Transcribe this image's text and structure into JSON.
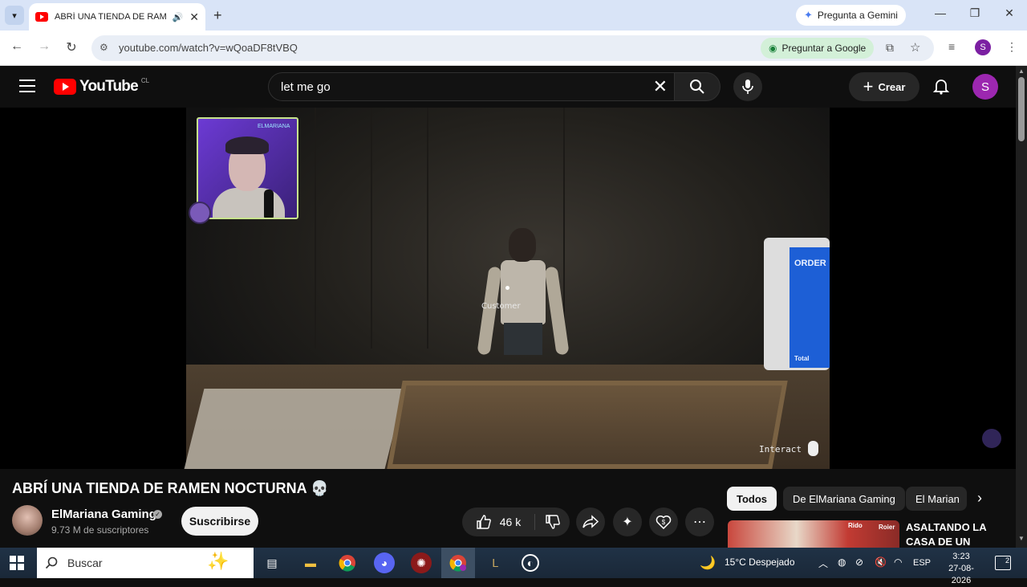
{
  "browser": {
    "tab_title": "ABRÍ UNA TIENDA DE RAMEN",
    "gemini_label": "Pregunta a Gemini",
    "url": "youtube.com/watch?v=wQoaDF8tVBQ",
    "ask_google_label": "Preguntar a Google",
    "profile_initial": "S"
  },
  "youtube": {
    "logo_text": "YouTube",
    "country_code": "CL",
    "search_query": "let me go",
    "create_label": "Crear",
    "avatar_initial": "S"
  },
  "video": {
    "game_label_customer": "Customer",
    "game_prompt_interact": "Interact",
    "kiosk_text": "ORDER",
    "kiosk_total": "Total",
    "webcam_badge": "ELMARIANA"
  },
  "watch": {
    "title": "ABRÍ UNA TIENDA DE RAMEN NOCTURNA 💀",
    "channel_name": "ElMariana Gaming",
    "subscribers": "9.73 M de suscriptores",
    "subscribe_label": "Suscribirse",
    "likes": "46 k"
  },
  "related": {
    "chips": [
      "Todos",
      "De ElMariana Gaming",
      "El Marian"
    ],
    "first_video_title": "ASALTANDO LA CASA DE UN",
    "thumb_labels": [
      "Rido",
      "Roier"
    ]
  },
  "taskbar": {
    "search_placeholder": "Buscar",
    "weather": "15°C  Despejado",
    "language": "ESP",
    "time": "3:23",
    "date": "27-08-2026",
    "notifications": "2"
  },
  "colors": {
    "youtube_red": "#ff0000",
    "yt_background": "#0f0f0f",
    "chrome_tabstrip": "#d9e4f7",
    "subscribe_button": "#f1f1f1",
    "avatar_purple": "#9c27b0"
  }
}
